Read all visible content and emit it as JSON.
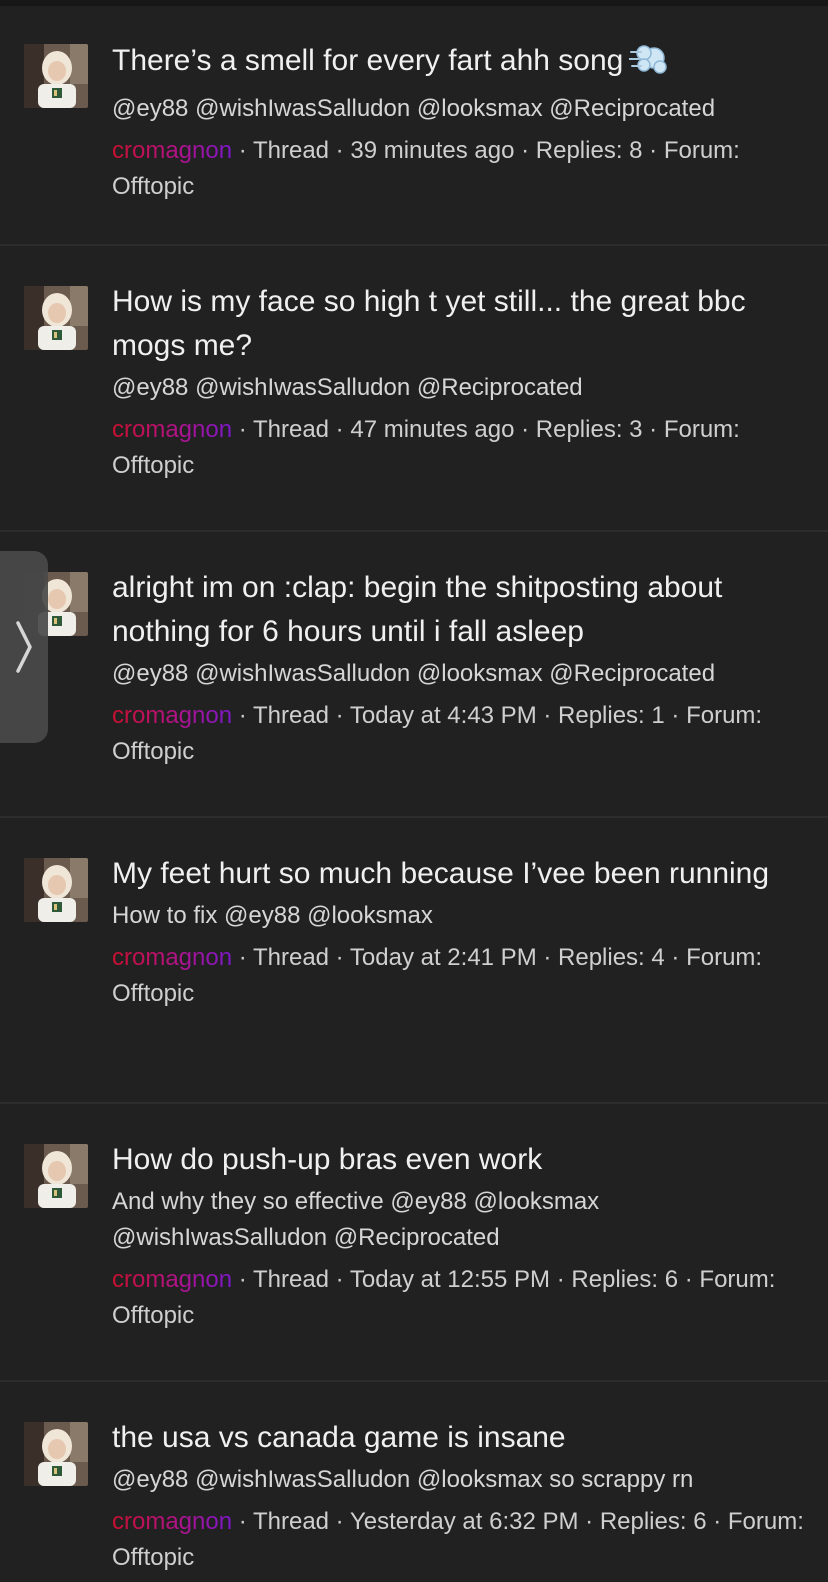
{
  "threads": [
    {
      "title": "There’s a smell for every fart ahh song",
      "title_emoji": "dash-icon",
      "snippet": "@ey88 @wishIwasSalludon @looksmax @Reciprocated",
      "author": "cromagnon",
      "meta_after": " · Thread · 39 minutes ago · Replies: 8 · Forum: Offtopic"
    },
    {
      "title": "How is my face so high t yet still... the great bbc mogs me?",
      "snippet": "@ey88 @wishIwasSalludon @Reciprocated",
      "author": "cromagnon",
      "meta_after": " · Thread · 47 minutes ago · Replies: 3 · Forum: Offtopic"
    },
    {
      "title": "alright im on :clap: begin the shitposting about nothing for 6 hours until i fall asleep",
      "snippet": "@ey88 @wishIwasSalludon @looksmax @Reciprocated",
      "author": "cromagnon",
      "meta_after": " · Thread · Today at 4:43 PM · Replies: 1 · Forum: Offtopic"
    },
    {
      "title": "My feet hurt so much because I’vee been running",
      "snippet": "How to fix @ey88 @looksmax",
      "author": "cromagnon",
      "meta_after": " · Thread · Today at 2:41 PM · Replies: 4 · Forum: Offtopic"
    },
    {
      "title": "How do push-up bras even work",
      "snippet": "And why they so effective @ey88 @looksmax @wishIwasSalludon @Reciprocated",
      "author": "cromagnon",
      "meta_after": " · Thread · Today at 12:55 PM · Replies: 6 · Forum: Offtopic"
    },
    {
      "title": "the usa vs canada game is insane",
      "snippet": "@ey88 @wishIwasSalludon @looksmax so scrappy rn",
      "author": "cromagnon",
      "meta_after": " · Thread · Yesterday at 6:32 PM · Replies: 6 · Forum: Offtopic"
    }
  ],
  "side_tab_icon": "chevron-right-icon"
}
